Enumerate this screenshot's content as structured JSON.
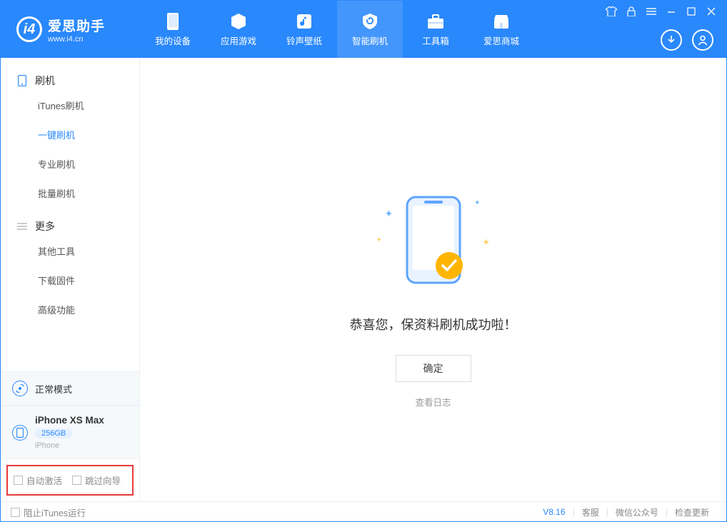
{
  "app": {
    "title": "爱思助手",
    "subtitle": "www.i4.cn"
  },
  "nav": {
    "tabs": [
      {
        "label": "我的设备"
      },
      {
        "label": "应用游戏"
      },
      {
        "label": "铃声壁纸"
      },
      {
        "label": "智能刷机"
      },
      {
        "label": "工具箱"
      },
      {
        "label": "爱思商城"
      }
    ]
  },
  "sidebar": {
    "group_flash": "刷机",
    "items_flash": [
      {
        "label": "iTunes刷机"
      },
      {
        "label": "一键刷机"
      },
      {
        "label": "专业刷机"
      },
      {
        "label": "批量刷机"
      }
    ],
    "group_more": "更多",
    "items_more": [
      {
        "label": "其他工具"
      },
      {
        "label": "下载固件"
      },
      {
        "label": "高级功能"
      }
    ],
    "mode_label": "正常模式",
    "device": {
      "name": "iPhone XS Max",
      "storage": "256GB",
      "type": "iPhone"
    },
    "opt_auto_activate": "自动激活",
    "opt_skip_guide": "跳过向导"
  },
  "main": {
    "success_msg": "恭喜您，保资料刷机成功啦！",
    "ok": "确定",
    "view_log": "查看日志"
  },
  "footer": {
    "block_itunes": "阻止iTunes运行",
    "version": "V8.16",
    "links": [
      {
        "label": "客服"
      },
      {
        "label": "微信公众号"
      },
      {
        "label": "检查更新"
      }
    ]
  }
}
